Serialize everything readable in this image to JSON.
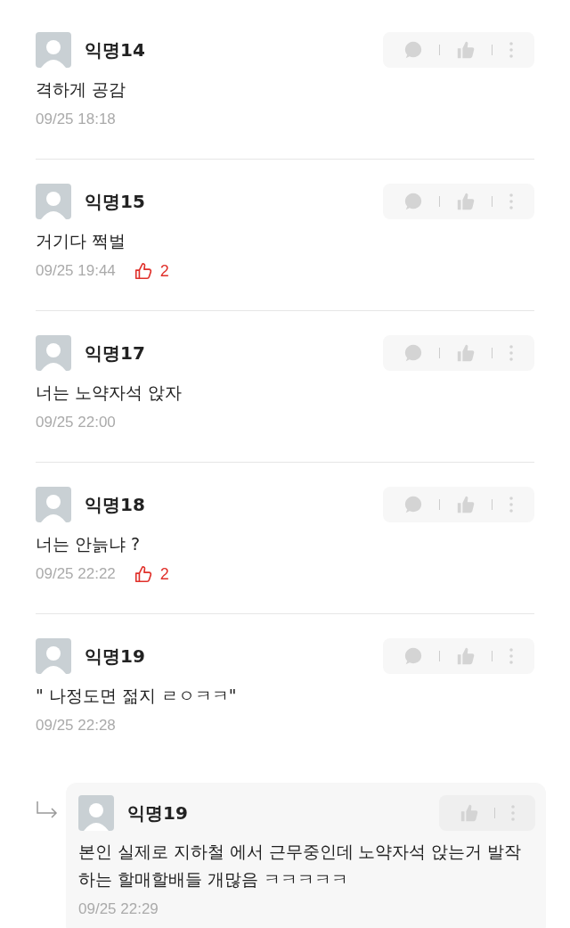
{
  "comments": [
    {
      "kind": "comment",
      "author": "익명14",
      "text": "격하게 공감",
      "time": "09/25 18:18"
    },
    {
      "kind": "comment",
      "author": "익명15",
      "text": "거기다 쩍벌",
      "time": "09/25 19:44",
      "likes": "2"
    },
    {
      "kind": "comment",
      "author": "익명17",
      "text": "너는 노약자석 앉자",
      "time": "09/25 22:00"
    },
    {
      "kind": "comment",
      "author": "익명18",
      "text": "너는 안늙냐 ?",
      "time": "09/25 22:22",
      "likes": "2"
    },
    {
      "kind": "comment",
      "author": "익명19",
      "text": "\" 나정도면 젊지 ㄹㅇㅋㅋ\"",
      "time": "09/25 22:28"
    },
    {
      "kind": "reply",
      "author": "익명19",
      "text": "본인 실제로 지하철 에서 근무중인데 노약자석 앉는거 발작하는 할매할배들 개많음 ㅋㅋㅋㅋㅋ",
      "time": "09/25 22:29"
    }
  ]
}
